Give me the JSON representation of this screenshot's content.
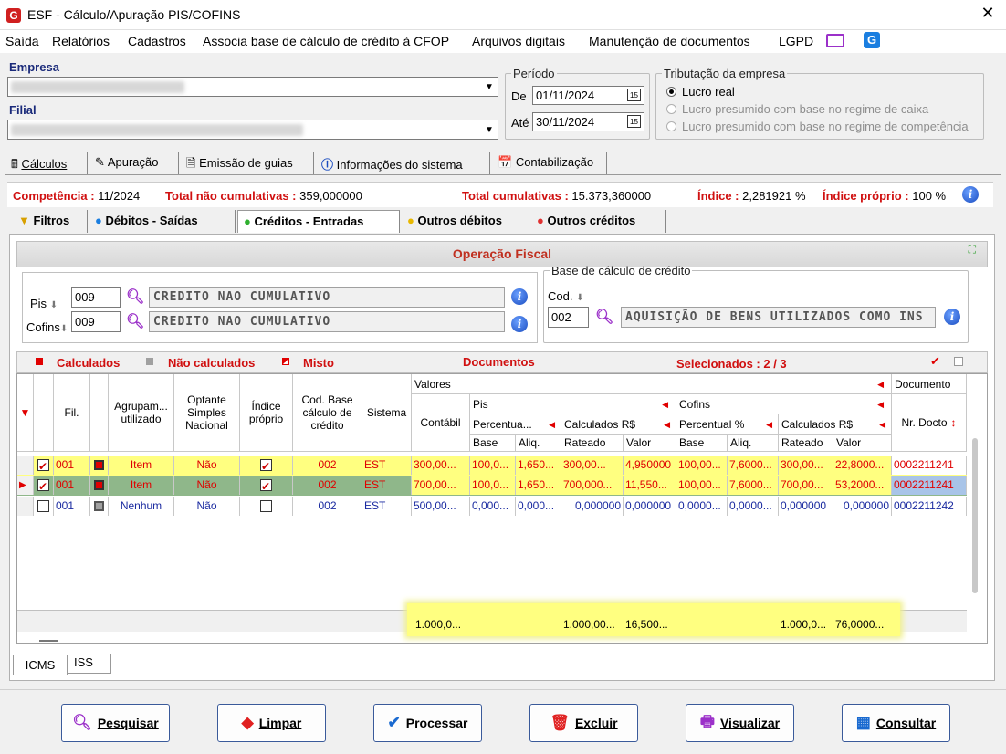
{
  "window": {
    "title": "ESF - Cálculo/Apuração PIS/COFINS",
    "logo": "G"
  },
  "menu": [
    "Saída",
    "Relatórios",
    "Cadastros",
    "Associa base de cálculo de crédito à CFOP",
    "Arquivos digitais",
    "Manutenção de documentos",
    "LGPD"
  ],
  "empresa": {
    "label": "Empresa"
  },
  "filial": {
    "label": "Filial"
  },
  "periodo": {
    "legend": "Período",
    "de_label": "De",
    "de": "01/11/2024",
    "ate_label": "Até",
    "ate": "30/11/2024"
  },
  "tributacao": {
    "legend": "Tributação da empresa",
    "opt1": "Lucro real",
    "opt2": "Lucro presumido com base no regime de caixa",
    "opt3": "Lucro presumido com base no regime de competência"
  },
  "tabs_main": [
    "Cálculos",
    "Apuração",
    "Emissão de guias",
    "Informações do sistema",
    "Contabilização"
  ],
  "status": {
    "competencia_label": "Competência :",
    "competencia": " 11/2024",
    "tnc_label": "Total não cumulativas :",
    "tnc": " 359,000000",
    "tc_label": "Total cumulativas :",
    "tc": " 15.373,360000",
    "indice_label": "Índice :",
    "indice": " 2,281921 %",
    "indprop_label": "Índice próprio :",
    "indprop": " 100 %"
  },
  "tabs_sub": [
    "Filtros",
    "Débitos - Saídas",
    "Créditos - Entradas",
    "Outros débitos",
    "Outros créditos"
  ],
  "operacao": {
    "title": "Operação Fiscal",
    "pis_label": "Pis",
    "pis_code": "009",
    "pis_desc": "CREDITO NAO CUMULATIVO",
    "cofins_label": "Cofins",
    "cofins_code": "009",
    "cofins_desc": "CREDITO NAO CUMULATIVO",
    "base_legend": "Base de cálculo de crédito",
    "cod_label": "Cod.",
    "cod": "002",
    "cod_desc": "AQUISIÇÃO DE BENS UTILIZADOS COMO INS"
  },
  "legend_bar": {
    "calculados": "Calculados",
    "nao_calculados": "Não calculados",
    "misto": "Misto",
    "documentos": "Documentos",
    "selecionados": "Selecionados : 2 / 3"
  },
  "headers": {
    "fil": "Fil.",
    "agrup": "Agrupam... utilizado",
    "optante": "Optante Simples Nacional",
    "indice": "Índice próprio",
    "codbase": "Cod. Base cálculo de crédito",
    "sistema": "Sistema",
    "valores": "Valores",
    "contabil": "Contábil",
    "pis": "Pis",
    "cofins": "Cofins",
    "percentual_pis": "Percentua...",
    "calc_pis": "Calculados R$",
    "percentual_cof": "Percentual %",
    "calc_cof": "Calculados R$",
    "base": "Base",
    "aliq": "Aliq.",
    "rateado": "Rateado",
    "valor": "Valor",
    "documento": "Documento",
    "nrdocto": "Nr. Docto"
  },
  "rows": [
    {
      "fil": "001",
      "agrup": "Item",
      "optante": "Não",
      "sistema": "EST",
      "cod": "002",
      "contabil": "300,00...",
      "pbase": "100,0...",
      "paliq": "1,650...",
      "prateado": "300,00...",
      "pvalor": "4,950000",
      "cbase": "100,00...",
      "caliq": "7,6000...",
      "crateado": "300,00...",
      "cvalor": "22,8000...",
      "doc": "0002211241"
    },
    {
      "fil": "001",
      "agrup": "Item",
      "optante": "Não",
      "sistema": "EST",
      "cod": "002",
      "contabil": "700,00...",
      "pbase": "100,0...",
      "paliq": "1,650...",
      "prateado": "700,000...",
      "pvalor": "11,550...",
      "cbase": "100,00...",
      "caliq": "7,6000...",
      "crateado": "700,00...",
      "cvalor": "53,2000...",
      "doc": "0002211241"
    },
    {
      "fil": "001",
      "agrup": "Nenhum",
      "optante": "Não",
      "sistema": "EST",
      "cod": "002",
      "contabil": "500,00...",
      "pbase": "0,000...",
      "paliq": "0,000...",
      "prateado": "0,000000",
      "pvalor": "0,000000",
      "cbase": "0,0000...",
      "caliq": "0,0000...",
      "crateado": "0,000000",
      "cvalor": "0,000000",
      "doc": "0002211242"
    }
  ],
  "totals": {
    "contabil": "1.000,0...",
    "prateado": "1.000,00...",
    "pvalor": "16,500...",
    "crateado": "1.000,0...",
    "cvalor": "76,0000..."
  },
  "bottom_tabs": [
    "ICMS",
    "ISS"
  ],
  "buttons": [
    "Pesquisar",
    "Limpar",
    "Processar",
    "Excluir",
    "Visualizar",
    "Consultar"
  ]
}
